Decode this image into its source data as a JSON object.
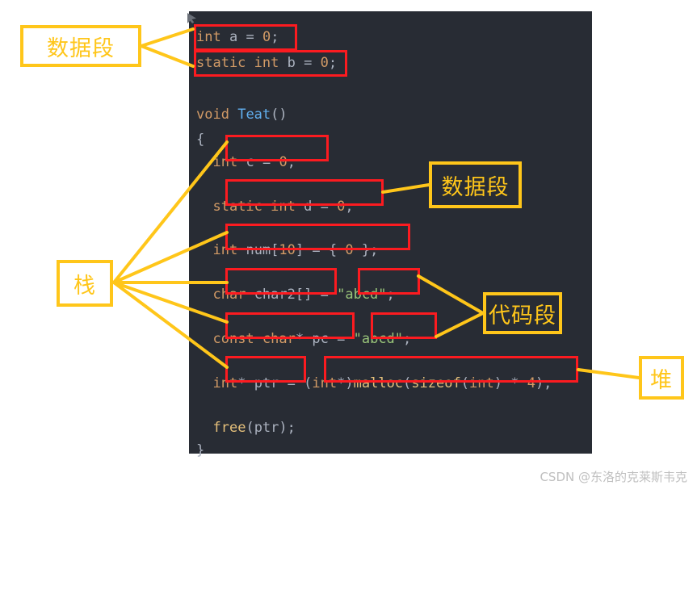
{
  "editor": {
    "background_color": "#282c34",
    "lines": [
      {
        "id": "line-int-a",
        "text": "int a = 0;"
      },
      {
        "id": "line-static-int-b",
        "text": "static int b = 0;"
      },
      {
        "id": "line-blank-1",
        "text": ""
      },
      {
        "id": "line-void-teat",
        "text": "void Teat()"
      },
      {
        "id": "line-open-brace",
        "text": "{"
      },
      {
        "id": "line-int-c",
        "text": "    int c = 0;"
      },
      {
        "id": "line-blank-2",
        "text": ""
      },
      {
        "id": "line-static-int-d",
        "text": "    static int d = 0;"
      },
      {
        "id": "line-blank-3",
        "text": ""
      },
      {
        "id": "line-int-num",
        "text": "    int num[10] = { 0 };"
      },
      {
        "id": "line-blank-4",
        "text": ""
      },
      {
        "id": "line-char-char2",
        "text": "    char char2[] = \"abcd\";"
      },
      {
        "id": "line-blank-5",
        "text": ""
      },
      {
        "id": "line-const-charp",
        "text": "    const char* pc = \"abcd\";"
      },
      {
        "id": "line-blank-6",
        "text": ""
      },
      {
        "id": "line-int-ptr",
        "text": "    int* ptr = (int*)malloc(sizeof(int) * 4);"
      },
      {
        "id": "line-blank-7",
        "text": ""
      },
      {
        "id": "line-free-ptr",
        "text": "    free(ptr);"
      },
      {
        "id": "line-close-brace",
        "text": "}"
      }
    ],
    "tokens": {
      "kw_int": "int",
      "kw_static": "static",
      "kw_void": "void",
      "kw_char": "char",
      "kw_const": "const",
      "fn_teat": "Teat",
      "id_a": "a",
      "id_b": "b",
      "id_c": "c",
      "id_d": "d",
      "id_num": "num",
      "id_char2": "char2",
      "id_pc": "pc",
      "id_ptr": "ptr",
      "num_0": "0",
      "num_10": "10",
      "num_4": "4",
      "str_abcd": "\"abcd\"",
      "call_malloc": "malloc",
      "call_sizeof": "sizeof",
      "call_free": "free"
    },
    "colors": {
      "keyword": "#d19a66",
      "function": "#61afef",
      "identifier": "#abb2bf",
      "string": "#98c379",
      "call": "#e5c07b",
      "punctuation": "#abb2bf"
    }
  },
  "annotations": {
    "highlight_color": "#fc1b20",
    "callout_color": "#ffc61a",
    "boxes": [
      {
        "id": "callout-data-segment-1",
        "label": "数据段",
        "meaning": "data-segment"
      },
      {
        "id": "callout-data-segment-2",
        "label": "数据段",
        "meaning": "data-segment"
      },
      {
        "id": "callout-stack",
        "label": "栈",
        "meaning": "stack"
      },
      {
        "id": "callout-code-segment",
        "label": "代码段",
        "meaning": "code-segment"
      },
      {
        "id": "callout-heap",
        "label": "堆",
        "meaning": "heap"
      }
    ]
  },
  "watermark": {
    "text": "CSDN @东洛的克莱斯韦克"
  }
}
